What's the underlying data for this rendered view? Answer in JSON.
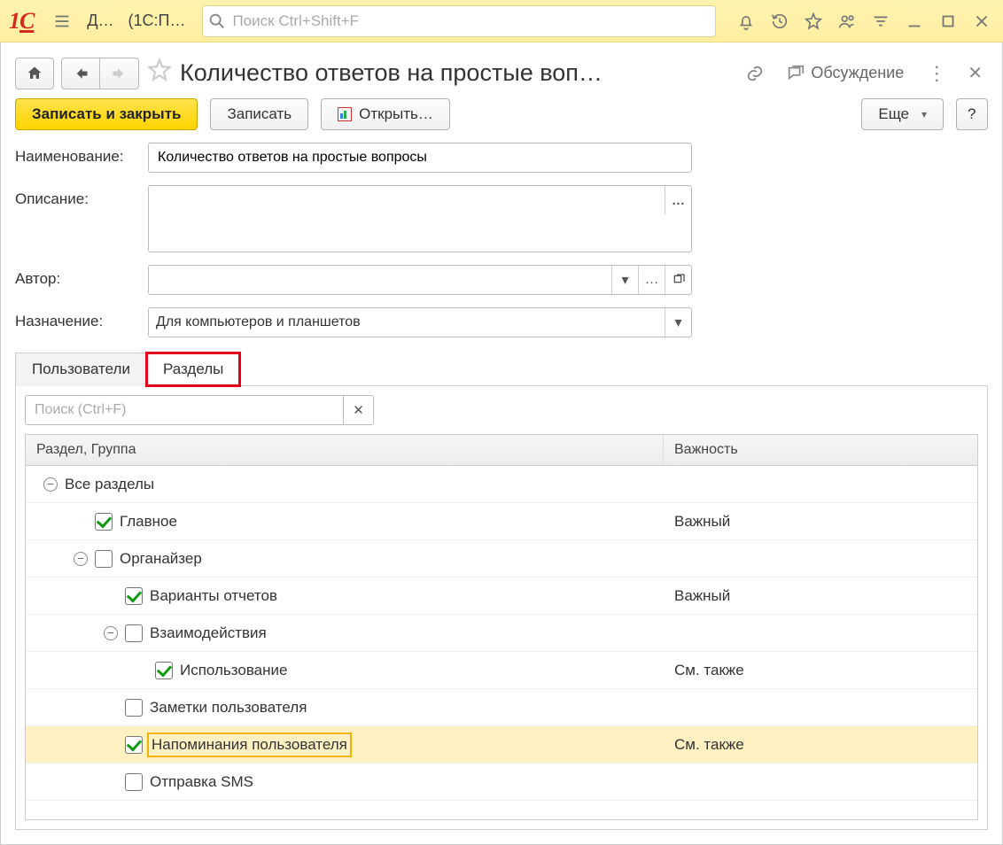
{
  "titlebar": {
    "app_abbrev": "Д…",
    "window_caption": "(1С:П…",
    "search_placeholder": "Поиск Ctrl+Shift+F"
  },
  "header": {
    "page_title": "Количество ответов на простые воп…",
    "discussion_label": "Обсуждение"
  },
  "cmdbar": {
    "save_close": "Записать и закрыть",
    "save": "Записать",
    "open": "Открыть…",
    "more": "Еще",
    "help": "?"
  },
  "form": {
    "name_label": "Наименование:",
    "name_value": "Количество ответов на простые вопросы",
    "desc_label": "Описание:",
    "desc_value": "",
    "author_label": "Автор:",
    "author_value": "",
    "dest_label": "Назначение:",
    "dest_value": "Для компьютеров и планшетов"
  },
  "tabs": {
    "users": "Пользователи",
    "sections": "Разделы"
  },
  "tree": {
    "search_placeholder": "Поиск (Ctrl+F)",
    "col_section": "Раздел, Группа",
    "col_importance": "Важность",
    "rows": [
      {
        "label": "Все разделы",
        "importance": "",
        "indent": "indent1t",
        "hasToggle": true,
        "hasCheckbox": false,
        "checked": false,
        "selected": false
      },
      {
        "label": "Главное",
        "importance": "Важный",
        "indent": "indent2",
        "hasToggle": false,
        "hasCheckbox": true,
        "checked": true,
        "selected": false
      },
      {
        "label": "Органайзер",
        "importance": "",
        "indent": "indent2t",
        "hasToggle": true,
        "hasCheckbox": true,
        "checked": false,
        "selected": false
      },
      {
        "label": "Варианты отчетов",
        "importance": "Важный",
        "indent": "indent3",
        "hasToggle": false,
        "hasCheckbox": true,
        "checked": true,
        "selected": false
      },
      {
        "label": "Взаимодействия",
        "importance": "",
        "indent": "indent3t",
        "hasToggle": true,
        "hasCheckbox": true,
        "checked": false,
        "selected": false
      },
      {
        "label": "Использование",
        "importance": "См. также",
        "indent": "indent4",
        "hasToggle": false,
        "hasCheckbox": true,
        "checked": true,
        "selected": false
      },
      {
        "label": "Заметки пользователя",
        "importance": "",
        "indent": "indent3",
        "hasToggle": false,
        "hasCheckbox": true,
        "checked": false,
        "selected": false
      },
      {
        "label": "Напоминания пользователя",
        "importance": "См. также",
        "indent": "indent3",
        "hasToggle": false,
        "hasCheckbox": true,
        "checked": true,
        "selected": true
      },
      {
        "label": "Отправка SMS",
        "importance": "",
        "indent": "indent3",
        "hasToggle": false,
        "hasCheckbox": true,
        "checked": false,
        "selected": false
      }
    ]
  }
}
